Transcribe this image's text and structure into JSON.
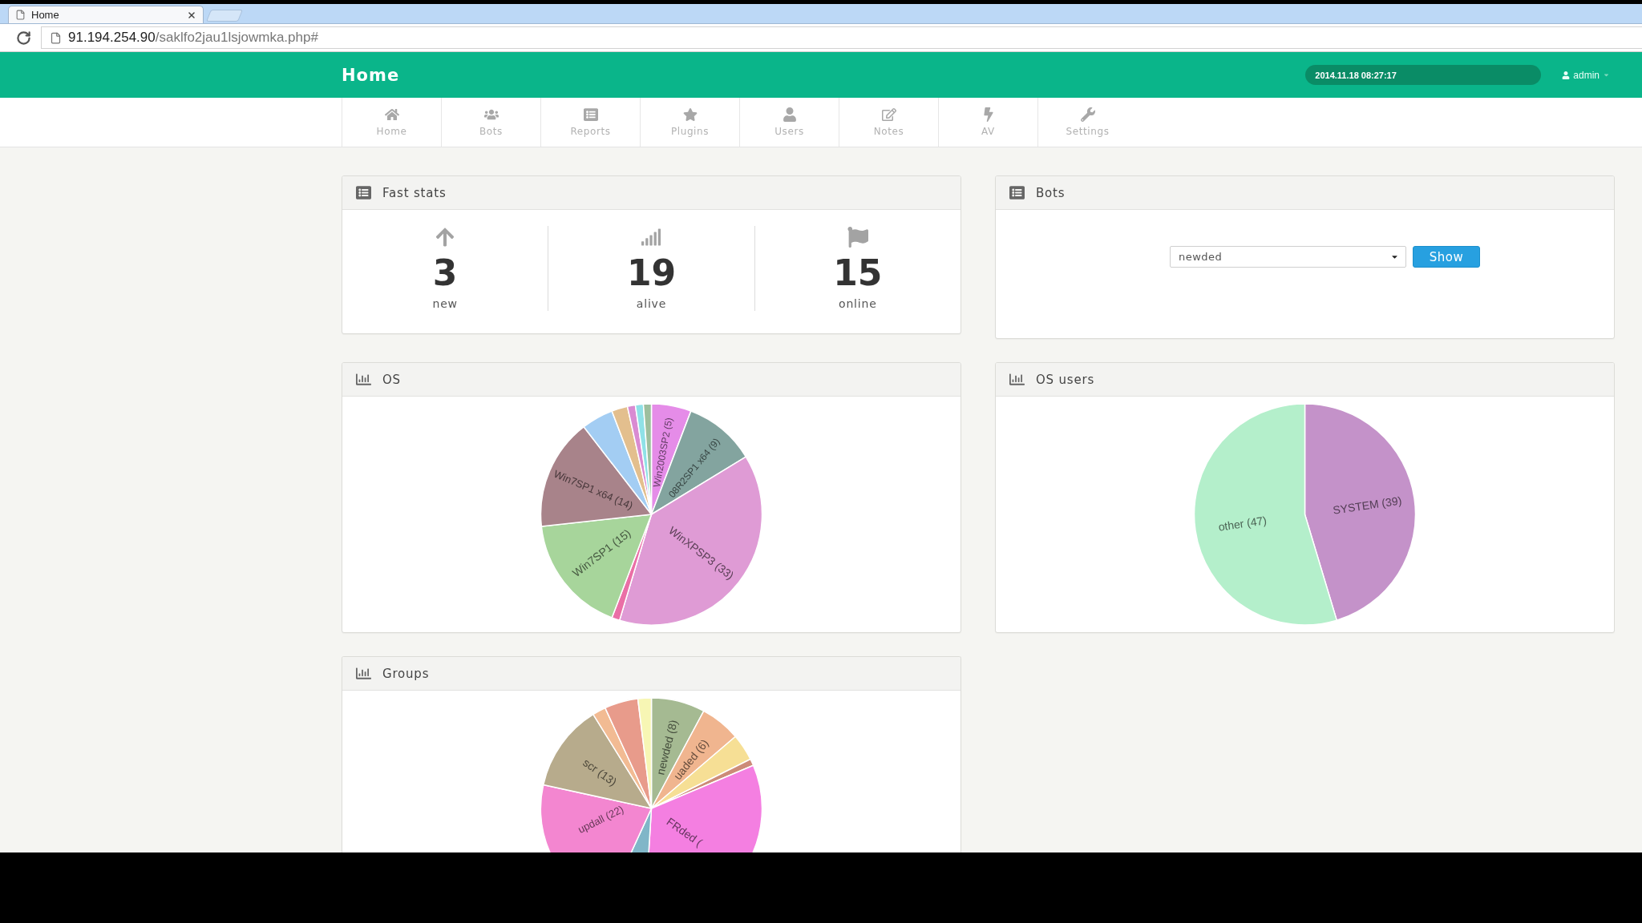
{
  "browser": {
    "tab": {
      "title": "Home"
    },
    "address": {
      "host": "91.194.254.90",
      "path": "/saklfo2jau1lsjowmka.php#"
    }
  },
  "header": {
    "title": "Home",
    "datetime": "2014.11.18 08:27:17",
    "user": "admin"
  },
  "nav": [
    {
      "label": "Home"
    },
    {
      "label": "Bots"
    },
    {
      "label": "Reports"
    },
    {
      "label": "Plugins"
    },
    {
      "label": "Users"
    },
    {
      "label": "Notes"
    },
    {
      "label": "AV"
    },
    {
      "label": "Settings"
    }
  ],
  "fast_stats": {
    "title": "Fast stats",
    "stats": [
      {
        "value": "3",
        "label": "new"
      },
      {
        "value": "19",
        "label": "alive"
      },
      {
        "value": "15",
        "label": "online"
      }
    ]
  },
  "bots": {
    "title": "Bots",
    "select": {
      "value": "newded"
    },
    "button": "Show"
  },
  "os": {
    "title": "OS",
    "chart_data": {
      "type": "pie",
      "categories": [
        "Win2003SP2 (5)",
        "08R2SP1 x64 (9)",
        "WinXPSP3 (33)",
        null,
        "Win7SP1 (15)",
        "Win7SP1 x64 (14)",
        null,
        null,
        null,
        null,
        null
      ],
      "values": [
        5,
        9,
        33,
        1,
        15,
        14,
        4,
        2,
        1,
        1,
        1
      ],
      "colors": [
        "#e58ce8",
        "#83a49f",
        "#df9bd5",
        "#ea6fa6",
        "#a7d59b",
        "#a8838a",
        "#a3cdf3",
        "#e3bf8e",
        "#d98bd2",
        "#8fe1e7",
        "#9dbf9e"
      ]
    }
  },
  "os_users": {
    "title": "OS users",
    "chart_data": {
      "type": "pie",
      "categories": [
        "SYSTEM (39)",
        "other (47)"
      ],
      "values": [
        39,
        47
      ],
      "colors": [
        "#c492c9",
        "#b4efcb"
      ]
    }
  },
  "groups": {
    "title": "Groups",
    "chart_data": {
      "type": "pie",
      "categories": [
        "newded (8)",
        "uaded (6)",
        null,
        null,
        "FRded (",
        null,
        "updall (22)",
        "scr (13)",
        null,
        null,
        null
      ],
      "values": [
        8,
        6,
        4,
        1,
        33,
        6,
        22,
        13,
        2,
        5,
        2
      ],
      "colors": [
        "#a5ba92",
        "#f0b58f",
        "#f6df95",
        "#cc8b78",
        "#f47fe1",
        "#80b6c8",
        "#f386d0",
        "#b7ab8c",
        "#f2bb93",
        "#e89b8b",
        "#f7f6b4"
      ]
    }
  }
}
